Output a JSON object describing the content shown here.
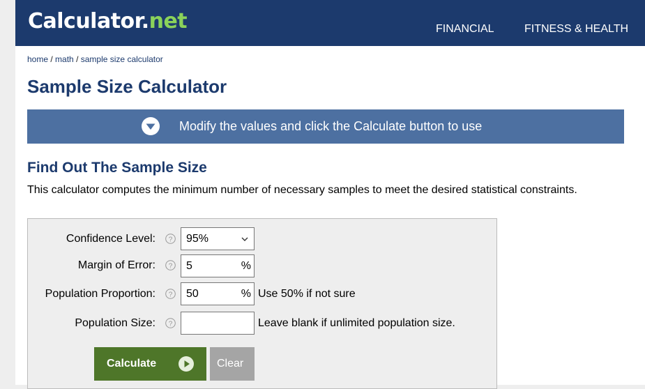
{
  "header": {
    "logo_text": "Calculator",
    "logo_dot": ".",
    "logo_net": "net",
    "nav": [
      "FINANCIAL",
      "FITNESS & HEALTH"
    ]
  },
  "breadcrumb": {
    "home": "home",
    "math": "math",
    "current": "sample size calculator",
    "separator": " / "
  },
  "title": "Sample Size Calculator",
  "banner": {
    "text": "Modify the values and click the Calculate button to use",
    "icon": "chevron-down-circle-icon"
  },
  "section": {
    "heading": "Find Out The Sample Size",
    "description": "This calculator computes the minimum number of necessary samples to meet the desired statistical constraints."
  },
  "form": {
    "confidence": {
      "label": "Confidence Level:",
      "value": "95%",
      "icon": "help-icon"
    },
    "margin": {
      "label": "Margin of Error:",
      "value": "5",
      "unit": "%",
      "icon": "help-icon"
    },
    "proportion": {
      "label": "Population Proportion:",
      "value": "50",
      "unit": "%",
      "hint": "Use 50% if not sure",
      "icon": "help-icon"
    },
    "population": {
      "label": "Population Size:",
      "value": "",
      "hint": "Leave blank if unlimited population size.",
      "icon": "help-icon"
    }
  },
  "buttons": {
    "calculate": "Calculate",
    "clear": "Clear"
  },
  "colors": {
    "brand_navy": "#1c3a6d",
    "banner_blue": "#4d70a1",
    "logo_green": "#8ad25a",
    "calculate_green": "#4e7629",
    "clear_gray": "#a5a5a5"
  }
}
